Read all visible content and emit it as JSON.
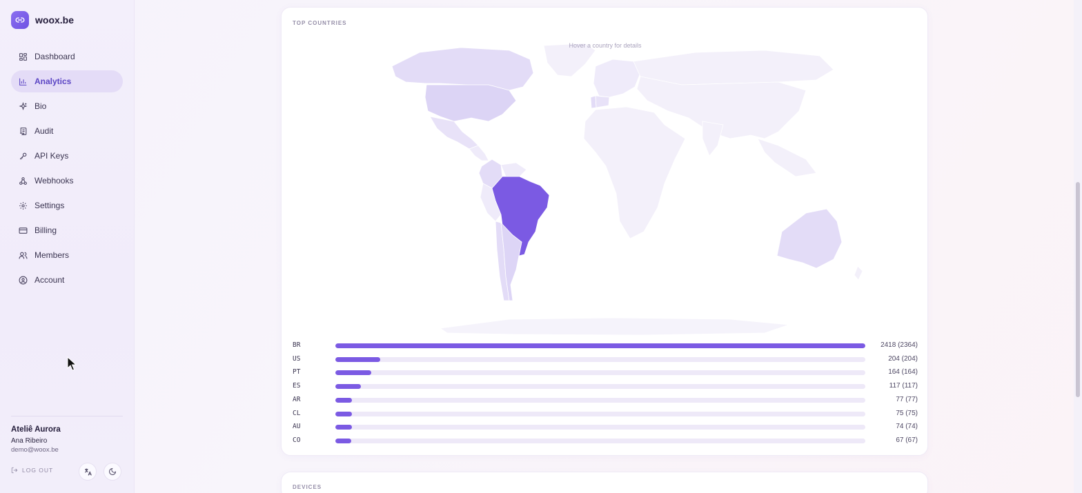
{
  "brand": {
    "name": "woox.be",
    "logo_icon": "link-icon"
  },
  "sidebar": {
    "items": [
      {
        "label": "Dashboard",
        "icon": "dashboard-icon",
        "active": false
      },
      {
        "label": "Analytics",
        "icon": "chart-icon",
        "active": true
      },
      {
        "label": "Bio",
        "icon": "sparkle-icon",
        "active": false
      },
      {
        "label": "Audit",
        "icon": "scroll-icon",
        "active": false
      },
      {
        "label": "API Keys",
        "icon": "key-icon",
        "active": false
      },
      {
        "label": "Webhooks",
        "icon": "webhook-icon",
        "active": false
      },
      {
        "label": "Settings",
        "icon": "gear-icon",
        "active": false
      },
      {
        "label": "Billing",
        "icon": "card-icon",
        "active": false
      },
      {
        "label": "Members",
        "icon": "users-icon",
        "active": false
      },
      {
        "label": "Account",
        "icon": "user-circle-icon",
        "active": false
      }
    ],
    "footer": {
      "org": "Ateliê Aurora",
      "user": "Ana Ribeiro",
      "email": "demo@woox.be",
      "logout_label": "LOG OUT",
      "translate_icon": "translate-icon",
      "theme_icon": "moon-icon"
    }
  },
  "countries_card": {
    "title": "TOP COUNTRIES",
    "map_hint": "Hover a country for details",
    "highlighted_country": "BR",
    "rows": [
      {
        "code": "BR",
        "count": "2418 (2364)",
        "value": 2418
      },
      {
        "code": "US",
        "count": "204 (204)",
        "value": 204
      },
      {
        "code": "PT",
        "count": "164 (164)",
        "value": 164
      },
      {
        "code": "ES",
        "count": "117 (117)",
        "value": 117
      },
      {
        "code": "AR",
        "count": "77 (77)",
        "value": 77
      },
      {
        "code": "CL",
        "count": "75 (75)",
        "value": 75
      },
      {
        "code": "AU",
        "count": "74 (74)",
        "value": 74
      },
      {
        "code": "CO",
        "count": "67 (67)",
        "value": 67
      }
    ]
  },
  "devices_card": {
    "title": "DEVICES"
  },
  "colors": {
    "accent": "#7b5ae3",
    "track": "#eee9f8",
    "map_light": "#f3f0fa",
    "map_mid": "#e3dcf7"
  }
}
